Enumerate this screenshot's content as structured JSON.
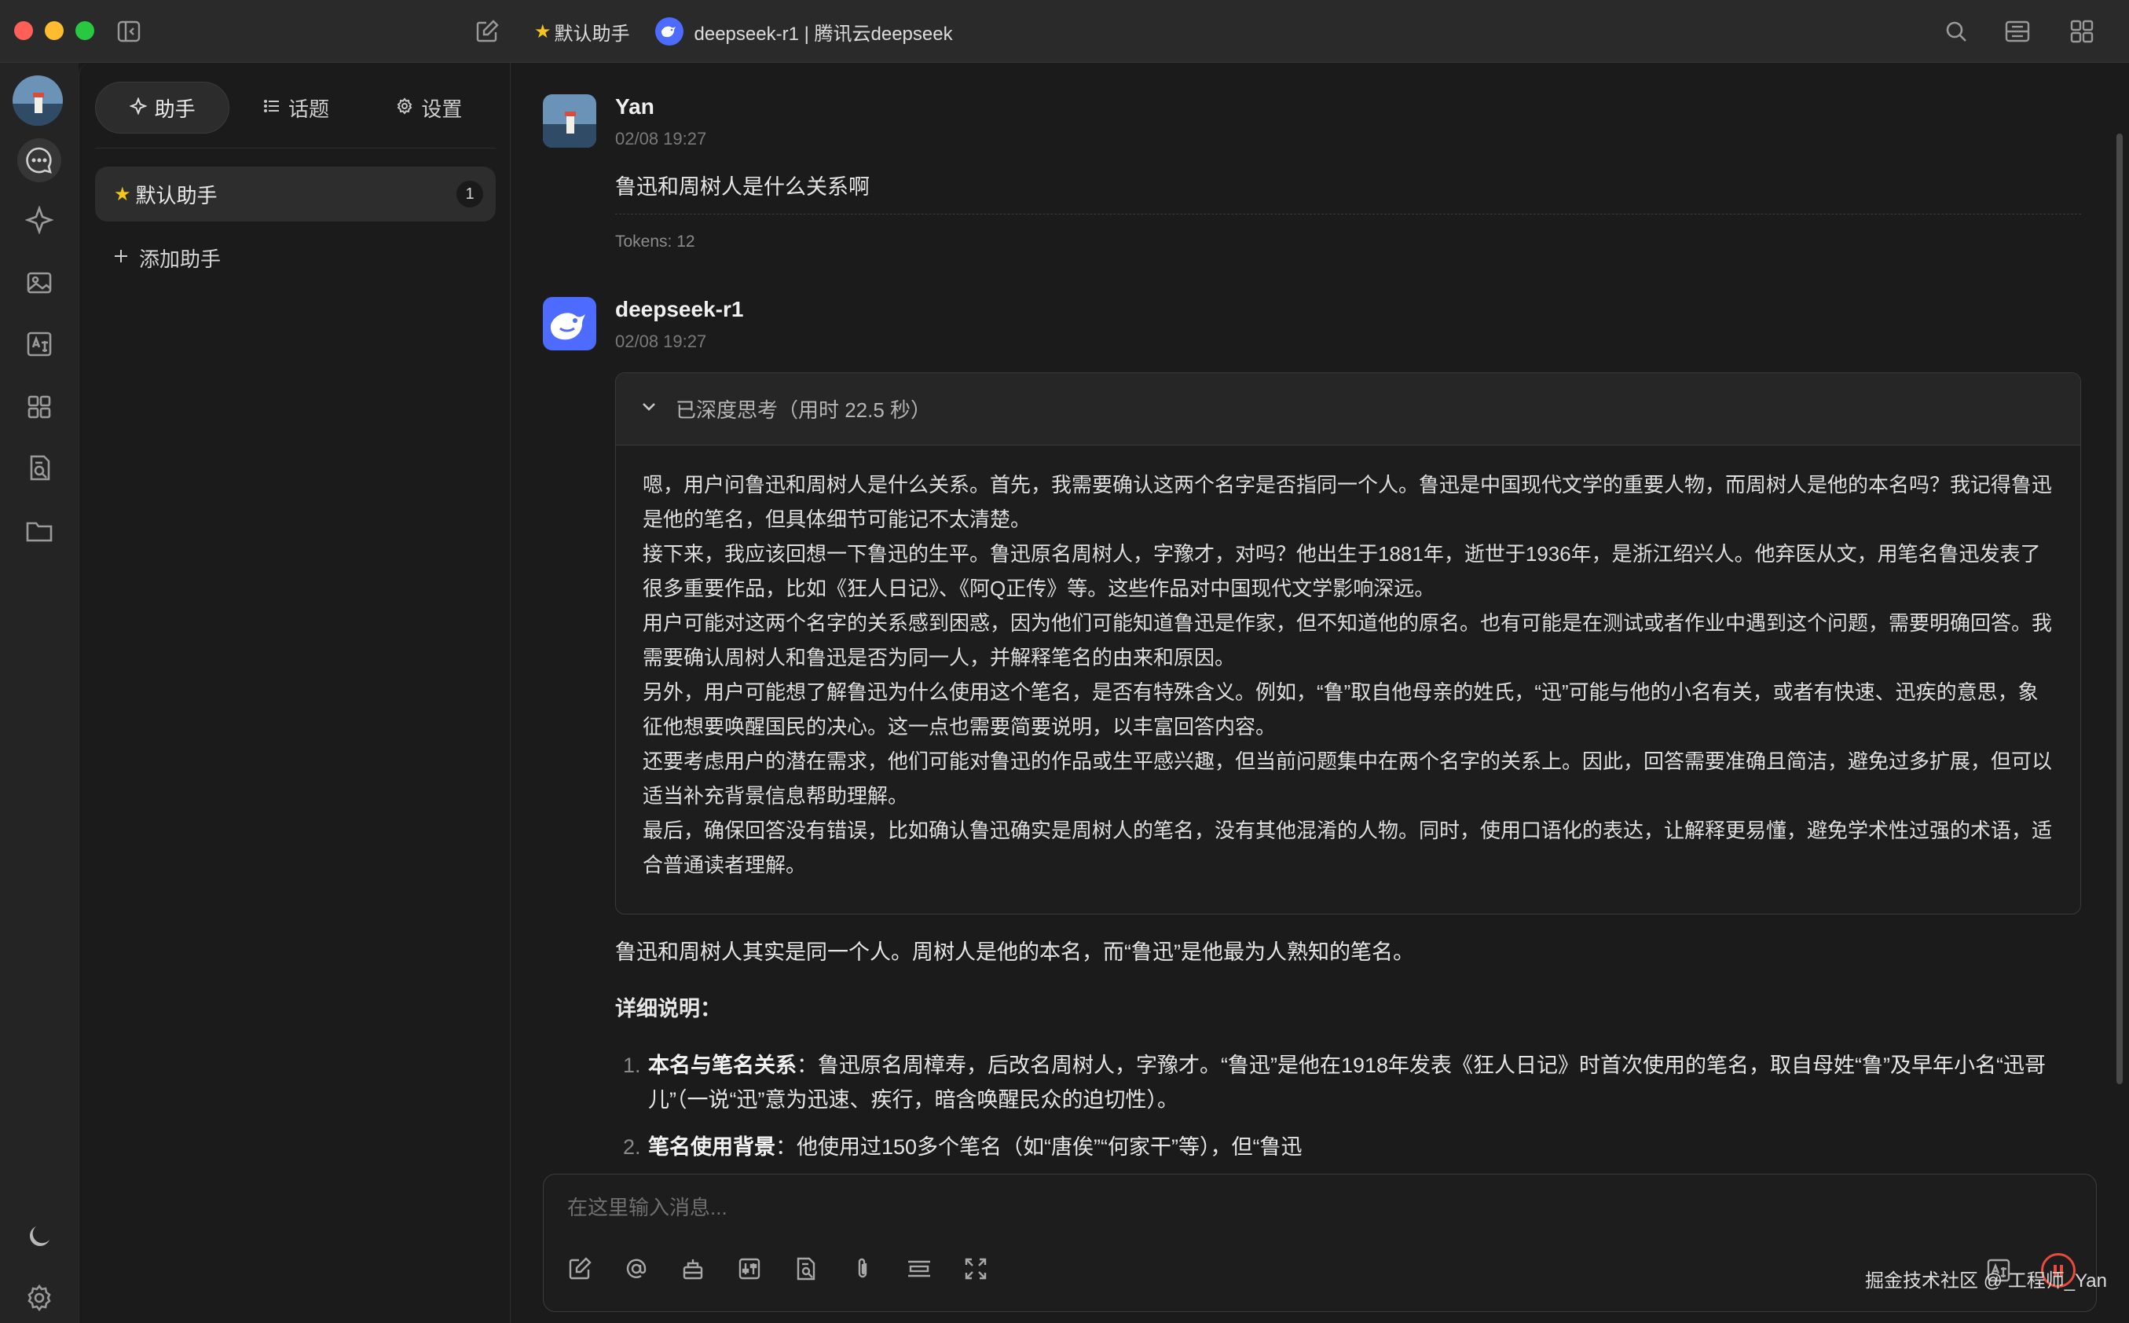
{
  "window": {
    "assistant_label": "默认助手",
    "model_title": "deepseek-r1 | 腾讯云deepseek"
  },
  "tabs": [
    {
      "label": "助手",
      "icon": "sparkle-icon"
    },
    {
      "label": "话题",
      "icon": "list-icon"
    },
    {
      "label": "设置",
      "icon": "gear-icon"
    }
  ],
  "assistants": [
    {
      "name": "默认助手",
      "count": "1"
    }
  ],
  "add_assistant_label": "添加助手",
  "messages": {
    "user": {
      "name": "Yan",
      "time": "02/08 19:27",
      "text": "鲁迅和周树人是什么关系啊",
      "tokens": "Tokens: 12"
    },
    "assistant": {
      "name": "deepseek-r1",
      "time": "02/08 19:27",
      "thinking_header": "已深度思考（用时 22.5 秒）",
      "thinking_paragraphs": [
        "嗯，用户问鲁迅和周树人是什么关系。首先，我需要确认这两个名字是否指同一个人。鲁迅是中国现代文学的重要人物，而周树人是他的本名吗？我记得鲁迅是他的笔名，但具体细节可能记不太清楚。",
        "接下来，我应该回想一下鲁迅的生平。鲁迅原名周树人，字豫才，对吗？他出生于1881年，逝世于1936年，是浙江绍兴人。他弃医从文，用笔名鲁迅发表了很多重要作品，比如《狂人日记》、《阿Q正传》等。这些作品对中国现代文学影响深远。",
        "用户可能对这两个名字的关系感到困惑，因为他们可能知道鲁迅是作家，但不知道他的原名。也有可能是在测试或者作业中遇到这个问题，需要明确回答。我需要确认周树人和鲁迅是否为同一人，并解释笔名的由来和原因。",
        "另外，用户可能想了解鲁迅为什么使用这个笔名，是否有特殊含义。例如，“鲁”取自他母亲的姓氏，“迅”可能与他的小名有关，或者有快速、迅疾的意思，象征他想要唤醒国民的决心。这一点也需要简要说明，以丰富回答内容。",
        "还要考虑用户的潜在需求，他们可能对鲁迅的作品或生平感兴趣，但当前问题集中在两个名字的关系上。因此，回答需要准确且简洁，避免过多扩展，但可以适当补充背景信息帮助理解。",
        "最后，确保回答没有错误，比如确认鲁迅确实是周树人的笔名，没有其他混淆的人物。同时，使用口语化的表达，让解释更易懂，避免学术性过强的术语，适合普通读者理解。"
      ],
      "answer_intro": "鲁迅和周树人其实是同一个人。周树人是他的本名，而“鲁迅”是他最为人熟知的笔名。",
      "answer_heading": "详细说明：",
      "answer_items": [
        {
          "num": "1.",
          "title": "本名与笔名关系",
          "text": "：鲁迅原名周樟寿，后改名周树人，字豫才。“鲁迅”是他在1918年发表《狂人日记》时首次使用的笔名，取自母姓“鲁”及早年小名“迅哥儿”（一说“迅”意为迅速、疾行，暗含唤醒民众的迫切性）。"
        },
        {
          "num": "2.",
          "title": "笔名使用背景",
          "text": "：他使用过150多个笔名（如“唐俟”“何家干”等），但“鲁迅"
        }
      ]
    }
  },
  "input": {
    "placeholder": "在这里输入消息..."
  },
  "watermark": "掘金技术社区 @ 工程师_Yan",
  "colors": {
    "accent": "#4d6bfe",
    "star": "#f5c518",
    "stop": "#e84a3c"
  }
}
